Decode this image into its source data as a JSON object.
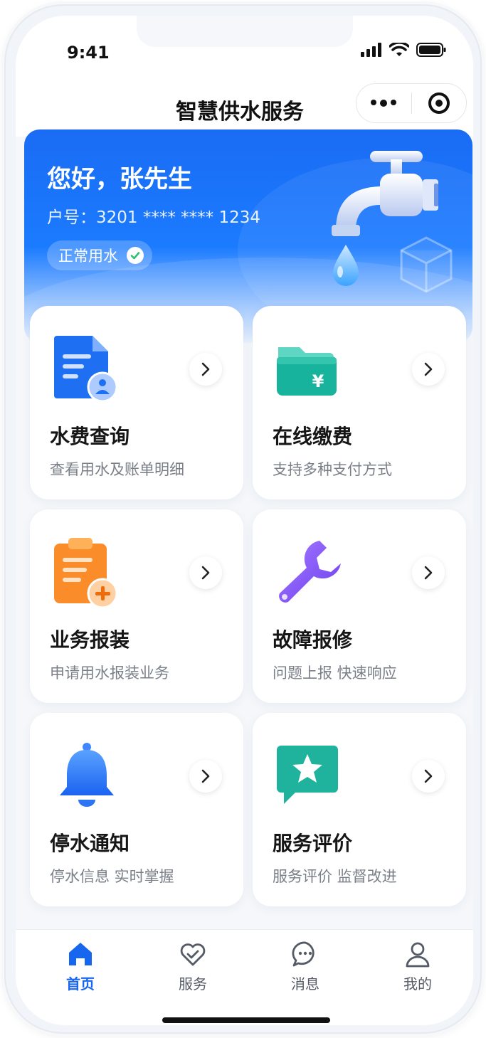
{
  "status_bar": {
    "time": "9:41"
  },
  "nav": {
    "title": "智慧供水服务"
  },
  "banner": {
    "greeting": "您好，张先生",
    "account": "户号：3201 **** **** 1234",
    "status_pill": "正常用水"
  },
  "cards": [
    {
      "title": "水费查询",
      "subtitle": "查看用水及账单明细",
      "icon": "document-user-icon"
    },
    {
      "title": "在线缴费",
      "subtitle": "支持多种支付方式",
      "icon": "wallet-yen-icon"
    },
    {
      "title": "业务报装",
      "subtitle": "申请用水报装业务",
      "icon": "clipboard-add-icon"
    },
    {
      "title": "故障报修",
      "subtitle": "问题上报  快速响应",
      "icon": "wrench-icon"
    },
    {
      "title": "停水通知",
      "subtitle": "停水信息  实时掌握",
      "icon": "bell-icon"
    },
    {
      "title": "服务评价",
      "subtitle": "服务评价  监督改进",
      "icon": "star-message-icon"
    }
  ],
  "tabbar": [
    {
      "label": "首页",
      "icon": "home-icon",
      "active": true
    },
    {
      "label": "服务",
      "icon": "heart-check-icon",
      "active": false
    },
    {
      "label": "消息",
      "icon": "chat-icon",
      "active": false
    },
    {
      "label": "我的",
      "icon": "user-icon",
      "active": false
    }
  ],
  "colors": {
    "primary": "#1766ef",
    "banner": "#1b7bff",
    "background": "#f5f7fa"
  }
}
